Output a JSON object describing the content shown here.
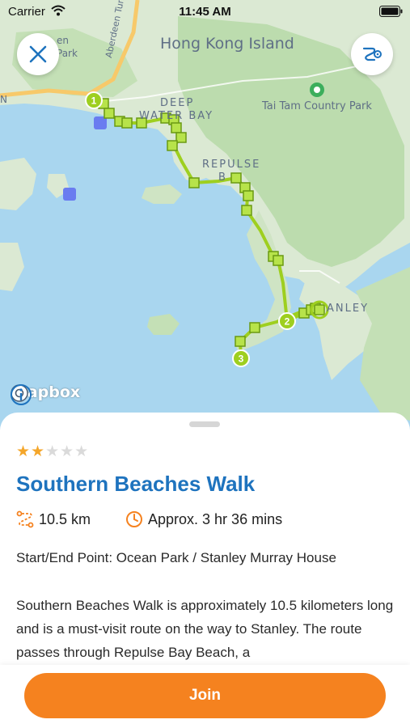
{
  "status_bar": {
    "carrier": "Carrier",
    "time": "11:45 AM"
  },
  "map": {
    "labels": {
      "hong_kong_island": "Hong Kong Island",
      "tai_tam": "Tai Tam Country Park",
      "deep": "DEEP",
      "water_bay": "WATER BAY",
      "repulse": "REPULSE",
      "bay_fragment": "B",
      "stanley": "ANLEY",
      "aberdeen_tunnel": "Aberdeen Tun",
      "top_left_1": "en",
      "top_left_2": "Park",
      "edge_n": "N"
    },
    "markers": [
      "1",
      "2",
      "3"
    ],
    "attribution": {
      "logo": "mapbox"
    },
    "route_color": "#9ecf1f"
  },
  "controls": {
    "close_icon": "close-icon",
    "settings_icon": "route-settings-icon"
  },
  "route": {
    "rating": 2,
    "rating_max": 5,
    "stars_filled": "★★",
    "stars_empty": "★★★",
    "title": "Southern Beaches Walk",
    "distance": "10.5 km",
    "duration": "Approx. 3 hr 36 mins",
    "start_end": "Start/End Point: Ocean Park / Stanley Murray House",
    "description": "Southern Beaches Walk is approximately 10.5 kilometers long and is a must-visit route on the way to Stanley. The route passes through Repulse Bay Beach, a"
  },
  "actions": {
    "join_label": "Join"
  },
  "colors": {
    "accent": "#f5821f",
    "title": "#1e73be",
    "star": "#f4a62a",
    "water": "#a9d6ef",
    "land": "#dbe9d3",
    "park": "#bcdcae"
  }
}
